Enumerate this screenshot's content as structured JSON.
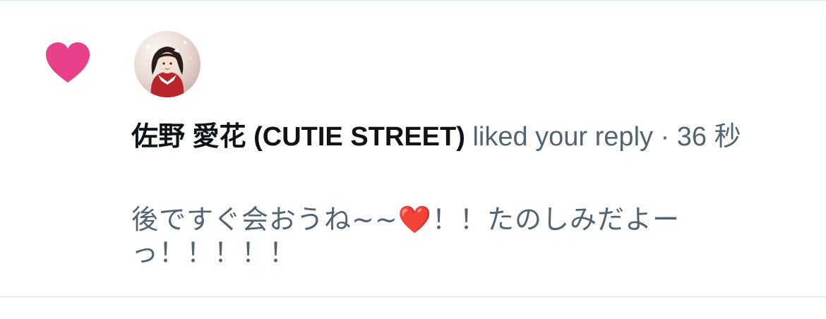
{
  "notification": {
    "user_name": "佐野 愛花 (CUTIE STREET)",
    "action": "liked your reply",
    "separator": "·",
    "time": "36 秒",
    "reply_text": "後ですぐ会おうね~~❤️！！たのしみだよーっ！！！！！",
    "like_icon": "heart-icon",
    "like_color": "#e8418a"
  }
}
